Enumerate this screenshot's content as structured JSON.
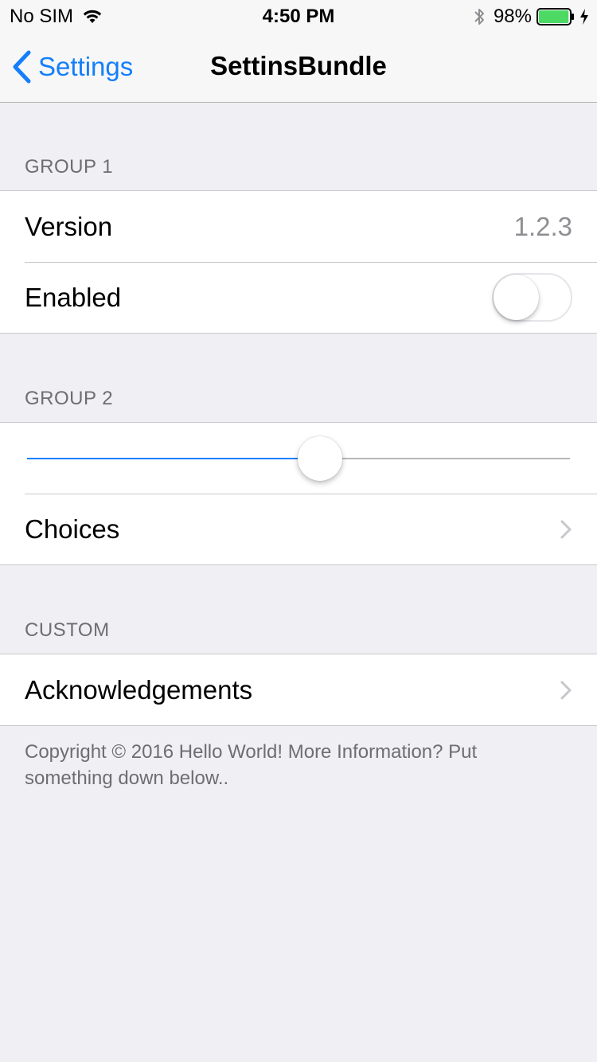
{
  "status_bar": {
    "carrier": "No SIM",
    "time": "4:50 PM",
    "battery": "98%",
    "battery_level": 0.98,
    "icons": [
      "wifi-icon",
      "bluetooth-icon",
      "battery-icon",
      "charging-icon"
    ]
  },
  "nav": {
    "back_label": "Settings",
    "title": "SettinsBundle"
  },
  "sections": {
    "group1": {
      "header": "GROUP 1",
      "version_label": "Version",
      "version_value": "1.2.3",
      "enabled_label": "Enabled",
      "enabled_on": false
    },
    "group2": {
      "header": "GROUP 2",
      "slider_value": 0.54,
      "choices_label": "Choices"
    },
    "custom": {
      "header": "CUSTOM",
      "acknowledgements_label": "Acknowledgements"
    }
  },
  "footer": {
    "text": "Copyright © 2016 Hello World! More Information? Put something down below.."
  },
  "colors": {
    "accent": "#147efb",
    "background": "#efeff4",
    "secondary_text": "#6d6d72",
    "battery_fill": "#4cd964"
  }
}
